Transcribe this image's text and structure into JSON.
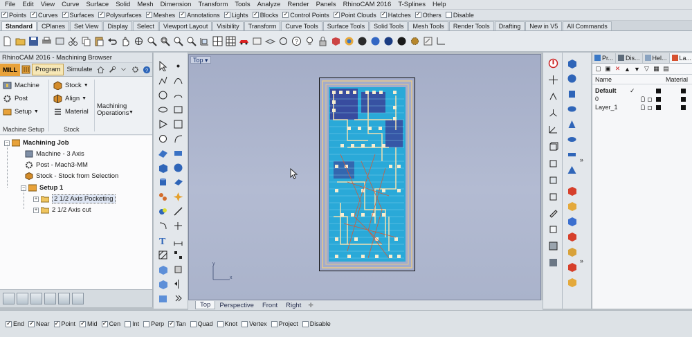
{
  "menu": [
    "File",
    "Edit",
    "View",
    "Curve",
    "Surface",
    "Solid",
    "Mesh",
    "Dimension",
    "Transform",
    "Tools",
    "Analyze",
    "Render",
    "Panels",
    "RhinoCAM 2016",
    "T-Splines",
    "Help"
  ],
  "filters": [
    {
      "label": "Points",
      "checked": true
    },
    {
      "label": "Curves",
      "checked": true
    },
    {
      "label": "Surfaces",
      "checked": true
    },
    {
      "label": "Polysurfaces",
      "checked": true
    },
    {
      "label": "Meshes",
      "checked": true
    },
    {
      "label": "Annotations",
      "checked": true
    },
    {
      "label": "Lights",
      "checked": true
    },
    {
      "label": "Blocks",
      "checked": true
    },
    {
      "label": "Control Points",
      "checked": true
    },
    {
      "label": "Point Clouds",
      "checked": true
    },
    {
      "label": "Hatches",
      "checked": true
    },
    {
      "label": "Others",
      "checked": true
    },
    {
      "label": "Disable",
      "checked": false
    }
  ],
  "toolbar_tabs": [
    "Standard",
    "CPlanes",
    "Set View",
    "Display",
    "Select",
    "Viewport Layout",
    "Visibility",
    "Transform",
    "Curve Tools",
    "Surface Tools",
    "Solid Tools",
    "Mesh Tools",
    "Render Tools",
    "Drafting",
    "New in V5",
    "All Commands"
  ],
  "toolbar_active": "Standard",
  "toolbar_icons": [
    "new-file",
    "open-file",
    "save",
    "print",
    "import",
    "cut",
    "copy",
    "paste",
    "undo",
    "pan",
    "rotate-view",
    "zoom",
    "zoom-window",
    "zoom-extents",
    "zoom-selected",
    "view-front",
    "view-4",
    "grid",
    "car-render",
    "properties",
    "layer",
    "circle-tool",
    "help",
    "lightbulb",
    "lock",
    "shaded",
    "color-wheel",
    "sphere-display",
    "sphere-render",
    "sphere-ghost",
    "sphere-xray",
    "gear-settings",
    "options",
    "cplane"
  ],
  "browser": {
    "title": "RhinoCAM 2016 - Machining Browser",
    "mill_label": "MILL",
    "tabs": [
      "Program",
      "Simulate"
    ],
    "active_tab": "Program",
    "ribbon": {
      "machine": "Machine",
      "post": "Post",
      "setup": "Setup",
      "stock": "Stock",
      "align": "Align",
      "material": "Material",
      "operations": "Machining\nOperations",
      "group_machine_setup": "Machine Setup",
      "group_stock": "Stock"
    },
    "tree": {
      "root": "Machining Job",
      "machine": "Machine - 3 Axis",
      "post": "Post - Mach3-MM",
      "stock": "Stock - Stock from Selection",
      "setup": "Setup 1",
      "op1": "2 1/2 Axis Pocketing",
      "op2": "2 1/2 Axis cut"
    }
  },
  "viewport": {
    "title": "Top",
    "axis_y": "y",
    "axis_x": "x",
    "tabs": [
      "Top",
      "Perspective",
      "Front",
      "Right"
    ],
    "active_tab": "Top",
    "colors": {
      "background": "#aab3cb",
      "pocket": "#2aa9d8",
      "traces": "#e7c98b",
      "drills": "#f4e9c6",
      "toolpath": "#e0542a",
      "dark_regions": "#3b3c95"
    }
  },
  "layers": {
    "tabs": [
      "Pr...",
      "Dis...",
      "Hel...",
      "La..."
    ],
    "active_tab": "La...",
    "col_name": "Name",
    "col_material": "Material",
    "rows": [
      {
        "name": "Default",
        "current": true,
        "bold": true
      },
      {
        "name": "0",
        "current": false,
        "bold": false
      },
      {
        "name": "Layer_1",
        "current": false,
        "bold": false
      }
    ],
    "current_mark": "✓"
  },
  "osnaps": [
    {
      "label": "End",
      "checked": true
    },
    {
      "label": "Near",
      "checked": true
    },
    {
      "label": "Point",
      "checked": true
    },
    {
      "label": "Mid",
      "checked": true
    },
    {
      "label": "Cen",
      "checked": true
    },
    {
      "label": "Int",
      "checked": false
    },
    {
      "label": "Perp",
      "checked": false
    },
    {
      "label": "Tan",
      "checked": true
    },
    {
      "label": "Quad",
      "checked": false
    },
    {
      "label": "Knot",
      "checked": false
    },
    {
      "label": "Vertex",
      "checked": false
    },
    {
      "label": "Project",
      "checked": false
    },
    {
      "label": "Disable",
      "checked": false
    }
  ]
}
